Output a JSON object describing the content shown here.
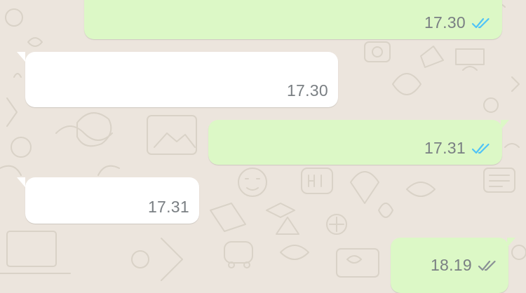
{
  "chat": {
    "messages": [
      {
        "direction": "outgoing",
        "time": "17.30",
        "status": "read"
      },
      {
        "direction": "incoming",
        "time": "17.30"
      },
      {
        "direction": "outgoing",
        "time": "17.31",
        "status": "read"
      },
      {
        "direction": "incoming",
        "time": "17.31"
      },
      {
        "direction": "outgoing",
        "time": "18.19",
        "status": "delivered"
      }
    ]
  },
  "colors": {
    "background": "#ECE5DD",
    "outgoing_bubble": "#DCF8C6",
    "incoming_bubble": "#FFFFFF",
    "read_tick": "#4FC3F7",
    "delivered_tick": "#8a9096",
    "time_text": "#7a7f83"
  },
  "icons": {
    "read": "double-check-blue-icon",
    "delivered": "double-check-grey-icon"
  }
}
